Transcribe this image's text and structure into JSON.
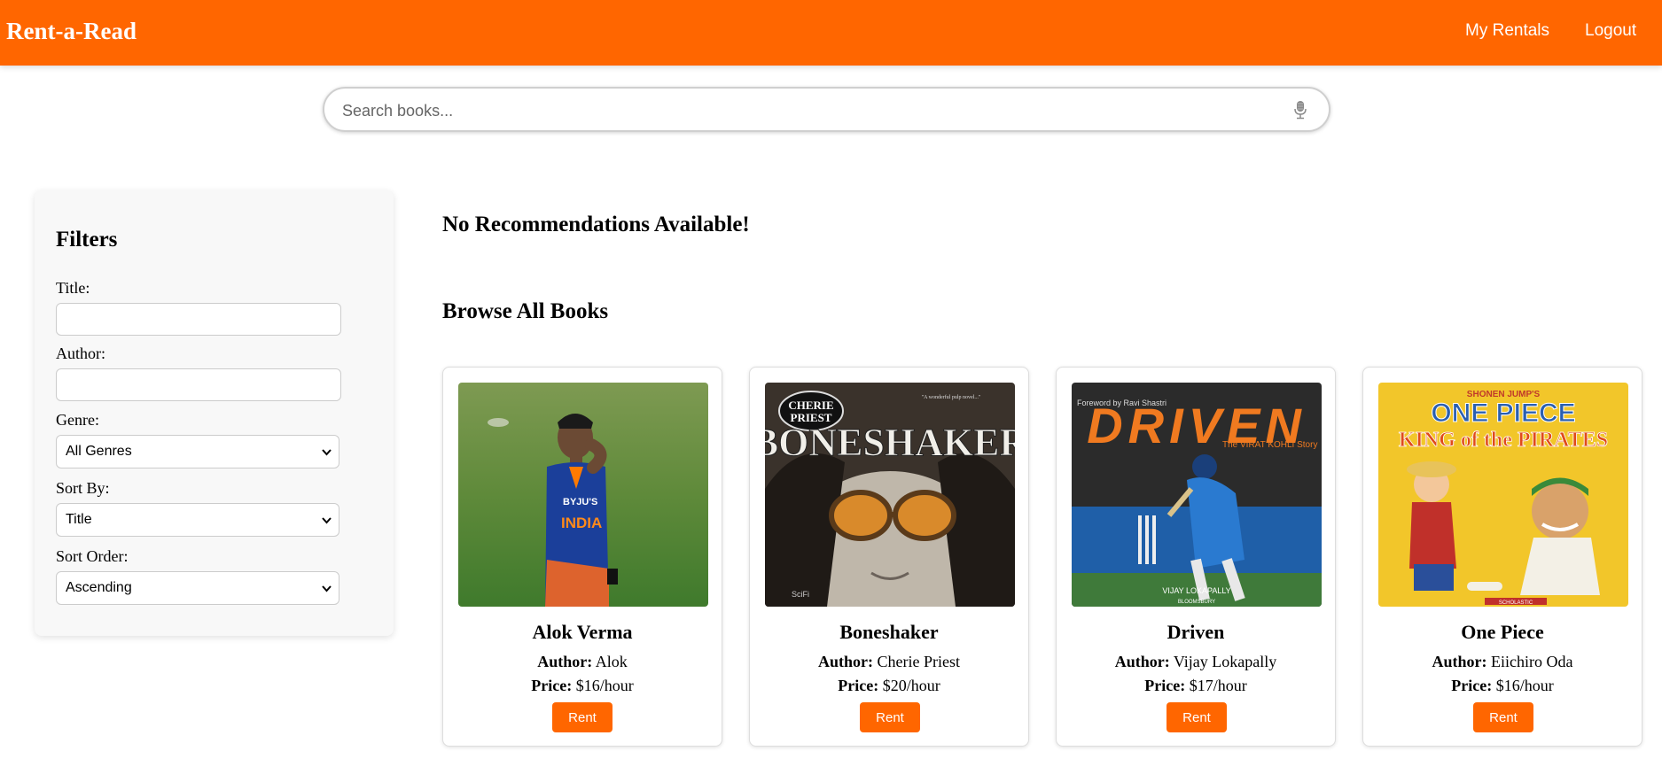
{
  "app": {
    "brand": "Rent-a-Read",
    "accent_color": "#ff6600"
  },
  "nav": {
    "my_rentals": "My Rentals",
    "logout": "Logout"
  },
  "search": {
    "placeholder": "Search books...",
    "value": "",
    "icon": "microphone-icon"
  },
  "filters": {
    "heading": "Filters",
    "title_label": "Title:",
    "title_value": "",
    "author_label": "Author:",
    "author_value": "",
    "genre_label": "Genre:",
    "genre_selected": "All Genres",
    "sort_by_label": "Sort By:",
    "sort_by_selected": "Title",
    "sort_order_label": "Sort Order:",
    "sort_order_selected": "Ascending"
  },
  "sections": {
    "recommendations": "No Recommendations Available!",
    "browse": "Browse All Books"
  },
  "labels": {
    "author": "Author:",
    "price": "Price:",
    "rent": "Rent"
  },
  "books": [
    {
      "title": "Alok Verma",
      "author": "Alok",
      "price": "$16/hour"
    },
    {
      "title": "Boneshaker",
      "author": "Cherie Priest",
      "price": "$20/hour"
    },
    {
      "title": "Driven",
      "author": "Vijay Lokapally",
      "price": "$17/hour"
    },
    {
      "title": "One Piece",
      "author": "Eiichiro Oda",
      "price": "$16/hour"
    }
  ],
  "covers": [
    {
      "text": []
    },
    {
      "text": [
        "CHERIE",
        "PRIEST",
        "BONESHAKER",
        "\"A wonderful pulp novel...\"",
        "SciFi"
      ]
    },
    {
      "text": [
        "Foreword by Ravi Shastri",
        "DRIVEN",
        "The VIRAT KOHLI Story",
        "VIJAY LOKAPALLY",
        "BLOOMSBURY"
      ]
    },
    {
      "text": [
        "SHONEN JUMP'S",
        "ONE PIECE",
        "KING of the PIRATES",
        "SCHOLASTIC"
      ]
    }
  ]
}
